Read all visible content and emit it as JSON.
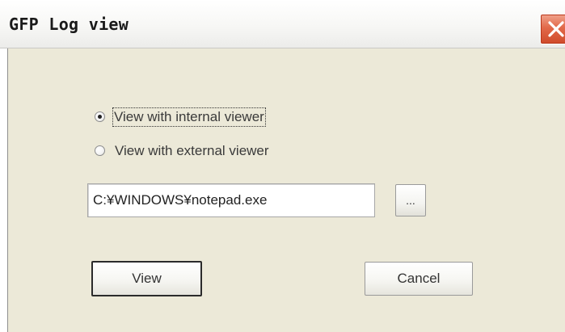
{
  "window": {
    "title": "GFP Log view",
    "close_icon": "close-x-icon"
  },
  "options": {
    "internal_label": "View with internal viewer",
    "external_label": "View with external viewer",
    "selected": "internal"
  },
  "path_field": {
    "value": "C:¥WINDOWS¥notepad.exe"
  },
  "browse": {
    "label": "..."
  },
  "actions": {
    "view_label": "View",
    "cancel_label": "Cancel"
  },
  "colors": {
    "dialog_face": "#ece9d8",
    "close_button": "#e2694a"
  }
}
